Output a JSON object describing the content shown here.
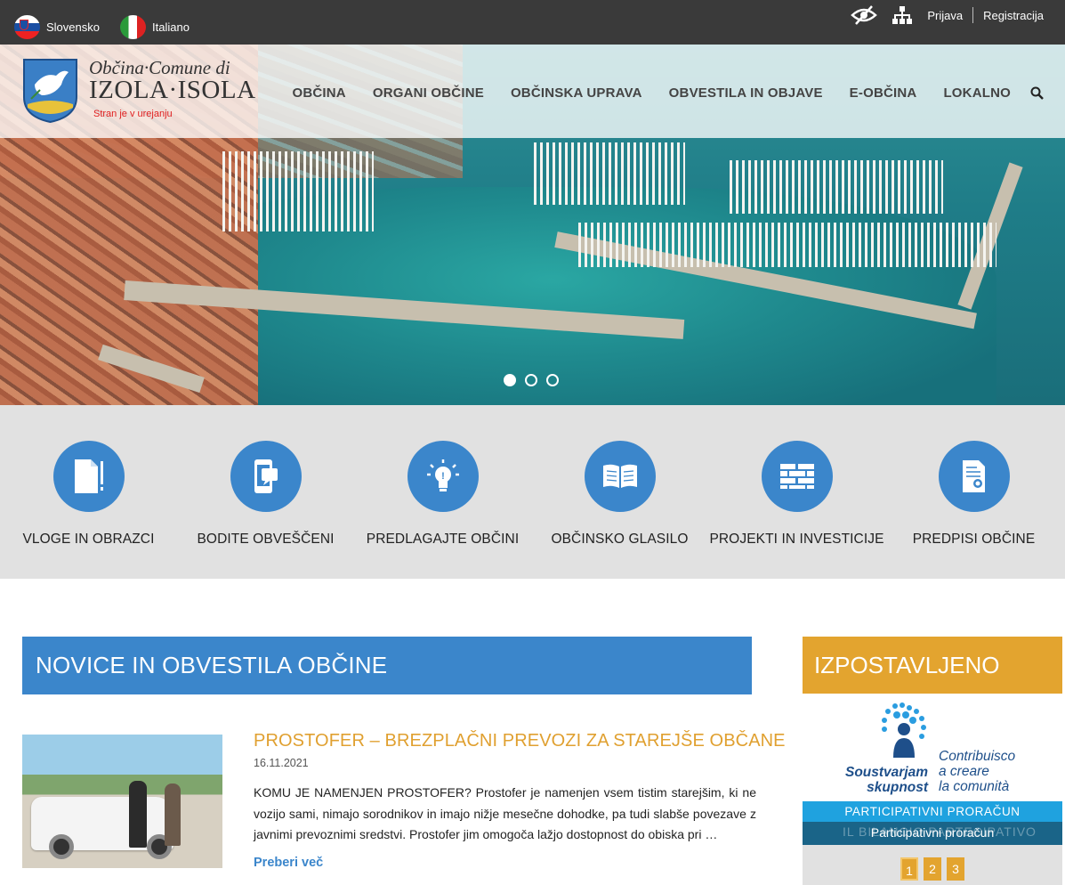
{
  "topbar": {
    "languages": [
      {
        "label": "Slovensko",
        "flag": "slovenia-flag-icon"
      },
      {
        "label": "Italiano",
        "flag": "italy-flag-icon"
      }
    ],
    "accessibility_icon": "eye-slash-icon",
    "sitemap_icon": "sitemap-icon",
    "login_label": "Prijava",
    "register_label": "Registracija"
  },
  "header": {
    "logo_top": "Občina·Comune di",
    "logo_main": "IZOLA·ISOLA",
    "logo_note": "Stran je v urejanju",
    "nav": [
      "OBČINA",
      "ORGANI OBČINE",
      "OBČINSKA UPRAVA",
      "OBVESTILA IN OBJAVE",
      "E-OBČINA",
      "LOKALNO"
    ],
    "search_icon": "search-icon"
  },
  "slider": {
    "slides": 3,
    "active": 1
  },
  "quick_links": [
    {
      "label": "VLOGE IN OBRAZCI",
      "icon": "document-icon"
    },
    {
      "label": "BODITE OBVEŠČENI",
      "icon": "mobile-notification-icon"
    },
    {
      "label": "PREDLAGAJTE OBČINI",
      "icon": "lightbulb-icon"
    },
    {
      "label": "OBČINSKO GLASILO",
      "icon": "open-book-icon"
    },
    {
      "label": "PROJEKTI IN INVESTICIJE",
      "icon": "brick-wall-icon"
    },
    {
      "label": "PREDPISI OBČINE",
      "icon": "certificate-icon"
    }
  ],
  "news": {
    "heading": "NOVICE IN OBVESTILA OBČINE",
    "item": {
      "title": "PROSTOFER – BREZPLAČNI PREVOZI ZA STAREJŠE OBČANE",
      "date": "16.11.2021",
      "text": "KOMU JE NAMENJEN PROSTOFER? Prostofer je namenjen vsem tistim starejšim, ki ne vozijo sami, nimajo sorodnikov in imajo nižje mesečne dohodke, pa tudi slabše povezave z javnimi prevoznimi sredstvi. Prostofer jim omogoča lažjo dostopnost do obiska pri …",
      "more": "Preberi več"
    }
  },
  "featured": {
    "heading": "IZPOSTAVLJENO",
    "slogan_sl": [
      "Soustvarjam",
      "skupnost"
    ],
    "slogan_it": [
      "Contribuisco",
      "a creare",
      "la comunità"
    ],
    "band1": "PARTICIPATIVNI PRORAČUN",
    "band2_ghost": "IL BILANCIO PARTECIPATIVO",
    "band2": "Participativni proračun",
    "pages": [
      "1",
      "2",
      "3"
    ],
    "active_page": "1"
  },
  "colors": {
    "blue": "#3b86cb",
    "orange": "#e3a42f",
    "topbar": "#3a3a3a"
  }
}
